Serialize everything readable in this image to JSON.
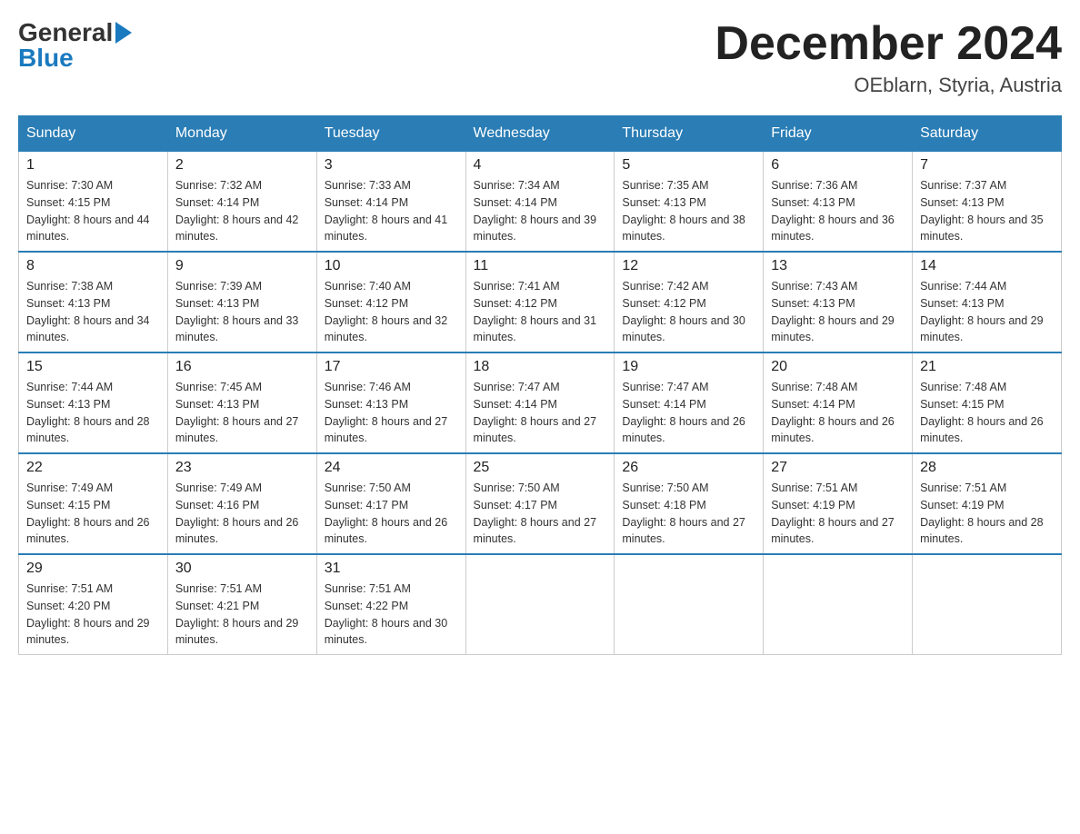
{
  "header": {
    "month_title": "December 2024",
    "location": "OEblarn, Styria, Austria",
    "logo_line1": "General",
    "logo_line2": "Blue"
  },
  "days_of_week": [
    "Sunday",
    "Monday",
    "Tuesday",
    "Wednesday",
    "Thursday",
    "Friday",
    "Saturday"
  ],
  "weeks": [
    [
      {
        "day": "1",
        "sunrise": "7:30 AM",
        "sunset": "4:15 PM",
        "daylight": "8 hours and 44 minutes."
      },
      {
        "day": "2",
        "sunrise": "7:32 AM",
        "sunset": "4:14 PM",
        "daylight": "8 hours and 42 minutes."
      },
      {
        "day": "3",
        "sunrise": "7:33 AM",
        "sunset": "4:14 PM",
        "daylight": "8 hours and 41 minutes."
      },
      {
        "day": "4",
        "sunrise": "7:34 AM",
        "sunset": "4:14 PM",
        "daylight": "8 hours and 39 minutes."
      },
      {
        "day": "5",
        "sunrise": "7:35 AM",
        "sunset": "4:13 PM",
        "daylight": "8 hours and 38 minutes."
      },
      {
        "day": "6",
        "sunrise": "7:36 AM",
        "sunset": "4:13 PM",
        "daylight": "8 hours and 36 minutes."
      },
      {
        "day": "7",
        "sunrise": "7:37 AM",
        "sunset": "4:13 PM",
        "daylight": "8 hours and 35 minutes."
      }
    ],
    [
      {
        "day": "8",
        "sunrise": "7:38 AM",
        "sunset": "4:13 PM",
        "daylight": "8 hours and 34 minutes."
      },
      {
        "day": "9",
        "sunrise": "7:39 AM",
        "sunset": "4:13 PM",
        "daylight": "8 hours and 33 minutes."
      },
      {
        "day": "10",
        "sunrise": "7:40 AM",
        "sunset": "4:12 PM",
        "daylight": "8 hours and 32 minutes."
      },
      {
        "day": "11",
        "sunrise": "7:41 AM",
        "sunset": "4:12 PM",
        "daylight": "8 hours and 31 minutes."
      },
      {
        "day": "12",
        "sunrise": "7:42 AM",
        "sunset": "4:12 PM",
        "daylight": "8 hours and 30 minutes."
      },
      {
        "day": "13",
        "sunrise": "7:43 AM",
        "sunset": "4:13 PM",
        "daylight": "8 hours and 29 minutes."
      },
      {
        "day": "14",
        "sunrise": "7:44 AM",
        "sunset": "4:13 PM",
        "daylight": "8 hours and 29 minutes."
      }
    ],
    [
      {
        "day": "15",
        "sunrise": "7:44 AM",
        "sunset": "4:13 PM",
        "daylight": "8 hours and 28 minutes."
      },
      {
        "day": "16",
        "sunrise": "7:45 AM",
        "sunset": "4:13 PM",
        "daylight": "8 hours and 27 minutes."
      },
      {
        "day": "17",
        "sunrise": "7:46 AM",
        "sunset": "4:13 PM",
        "daylight": "8 hours and 27 minutes."
      },
      {
        "day": "18",
        "sunrise": "7:47 AM",
        "sunset": "4:14 PM",
        "daylight": "8 hours and 27 minutes."
      },
      {
        "day": "19",
        "sunrise": "7:47 AM",
        "sunset": "4:14 PM",
        "daylight": "8 hours and 26 minutes."
      },
      {
        "day": "20",
        "sunrise": "7:48 AM",
        "sunset": "4:14 PM",
        "daylight": "8 hours and 26 minutes."
      },
      {
        "day": "21",
        "sunrise": "7:48 AM",
        "sunset": "4:15 PM",
        "daylight": "8 hours and 26 minutes."
      }
    ],
    [
      {
        "day": "22",
        "sunrise": "7:49 AM",
        "sunset": "4:15 PM",
        "daylight": "8 hours and 26 minutes."
      },
      {
        "day": "23",
        "sunrise": "7:49 AM",
        "sunset": "4:16 PM",
        "daylight": "8 hours and 26 minutes."
      },
      {
        "day": "24",
        "sunrise": "7:50 AM",
        "sunset": "4:17 PM",
        "daylight": "8 hours and 26 minutes."
      },
      {
        "day": "25",
        "sunrise": "7:50 AM",
        "sunset": "4:17 PM",
        "daylight": "8 hours and 27 minutes."
      },
      {
        "day": "26",
        "sunrise": "7:50 AM",
        "sunset": "4:18 PM",
        "daylight": "8 hours and 27 minutes."
      },
      {
        "day": "27",
        "sunrise": "7:51 AM",
        "sunset": "4:19 PM",
        "daylight": "8 hours and 27 minutes."
      },
      {
        "day": "28",
        "sunrise": "7:51 AM",
        "sunset": "4:19 PM",
        "daylight": "8 hours and 28 minutes."
      }
    ],
    [
      {
        "day": "29",
        "sunrise": "7:51 AM",
        "sunset": "4:20 PM",
        "daylight": "8 hours and 29 minutes."
      },
      {
        "day": "30",
        "sunrise": "7:51 AM",
        "sunset": "4:21 PM",
        "daylight": "8 hours and 29 minutes."
      },
      {
        "day": "31",
        "sunrise": "7:51 AM",
        "sunset": "4:22 PM",
        "daylight": "8 hours and 30 minutes."
      },
      null,
      null,
      null,
      null
    ]
  ],
  "labels": {
    "sunrise": "Sunrise:",
    "sunset": "Sunset:",
    "daylight": "Daylight:"
  }
}
